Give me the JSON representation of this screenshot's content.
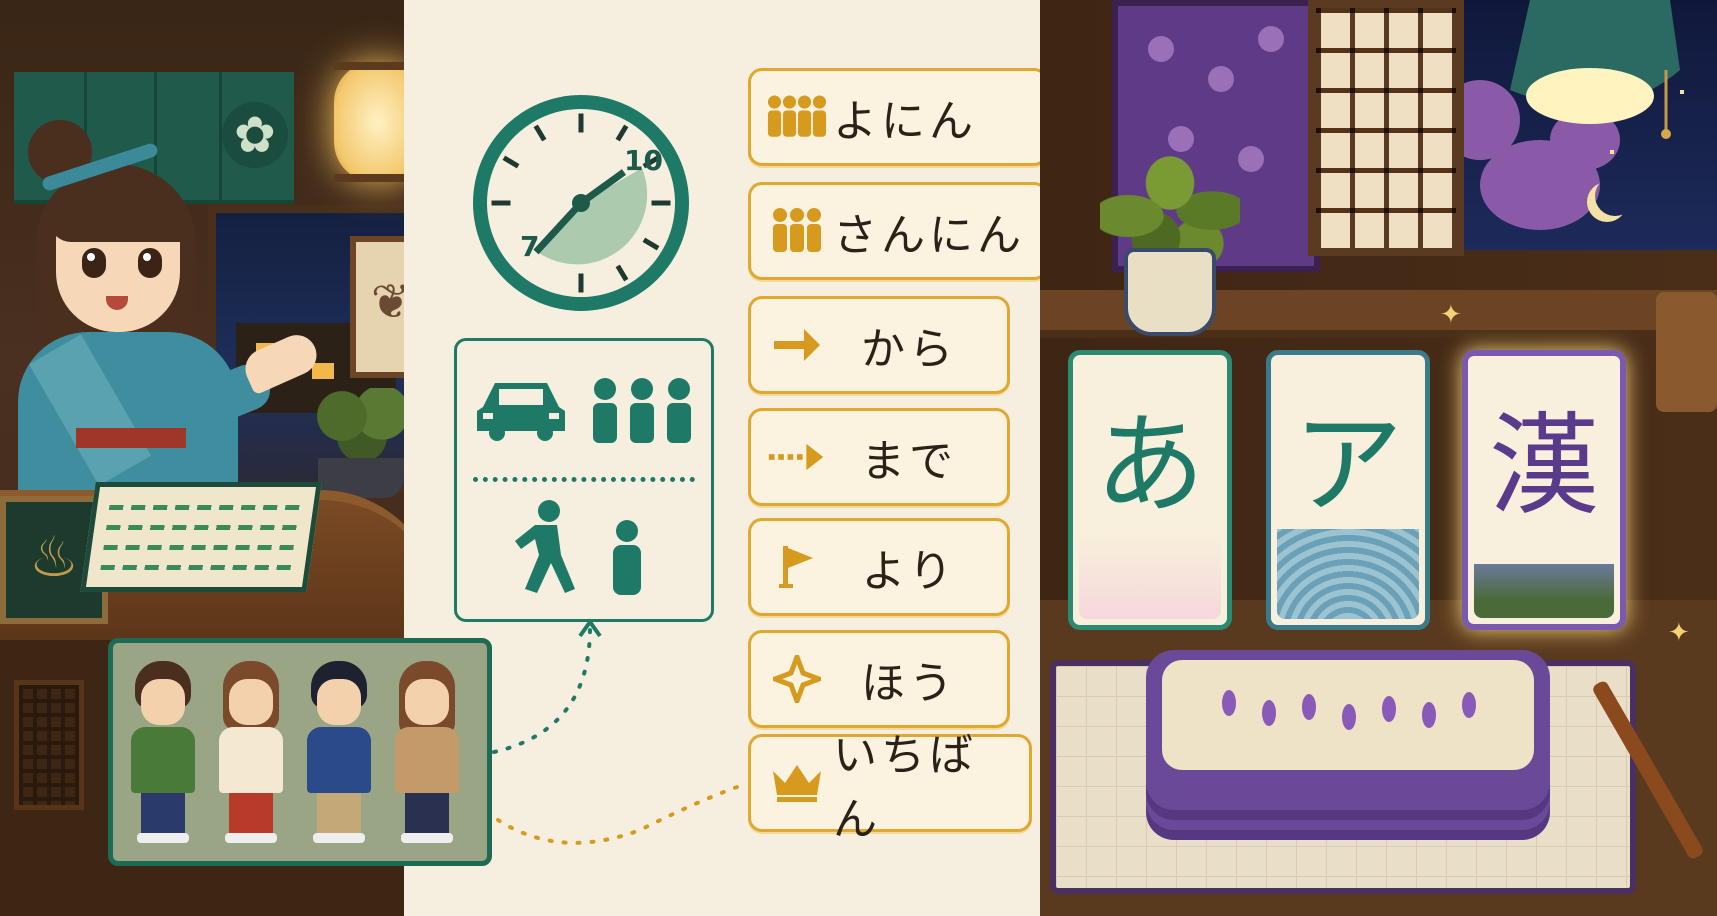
{
  "cards": [
    {
      "word": "よにん",
      "icon": "four-people-icon",
      "icon_glyph": "♟♟♟♟"
    },
    {
      "word": "さんにん",
      "icon": "three-people-icon",
      "icon_glyph": "♟♟♟"
    },
    {
      "word": "から",
      "icon": "arrow-right-icon",
      "icon_glyph": "➔"
    },
    {
      "word": "まで",
      "icon": "dotted-arrow-icon",
      "icon_glyph": "⋯➔"
    },
    {
      "word": "より",
      "icon": "flag-icon",
      "icon_glyph": "⚑"
    },
    {
      "word": "ほう",
      "icon": "sparkle-icon",
      "icon_glyph": "✧"
    },
    {
      "word": "いちばん",
      "icon": "crown-icon",
      "icon_glyph": "♛"
    }
  ],
  "clock": {
    "label_start": "7",
    "label_end": "10"
  },
  "kana_cards": [
    {
      "glyph": "あ",
      "name": "hiragana-card",
      "color": "#1e7a66"
    },
    {
      "glyph": "ア",
      "name": "katakana-card",
      "color": "#1e7a66"
    },
    {
      "glyph": "漢",
      "name": "kanji-card",
      "color": "#5a3a8a"
    }
  ],
  "colors": {
    "gold": "#d69a1e",
    "teal": "#1e7a66",
    "paper": "#f6efe0",
    "purple": "#6a4a98"
  }
}
